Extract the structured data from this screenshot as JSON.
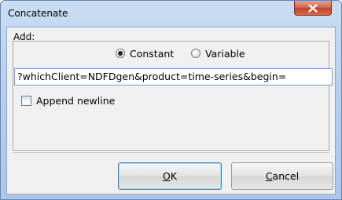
{
  "window": {
    "title": "Concatenate",
    "close_icon": "close-x-icon"
  },
  "form": {
    "add_label": "Add:",
    "radio_options": [
      {
        "label": "Constant",
        "selected": true
      },
      {
        "label": "Variable",
        "selected": false
      }
    ],
    "input_value": "?whichClient=NDFDgen&product=time-series&begin=",
    "append_newline": {
      "label": "Append newline",
      "checked": false
    }
  },
  "buttons": {
    "ok": {
      "mnemonic": "O",
      "rest": "K"
    },
    "cancel": {
      "mnemonic": "C",
      "rest": "ancel"
    }
  }
}
